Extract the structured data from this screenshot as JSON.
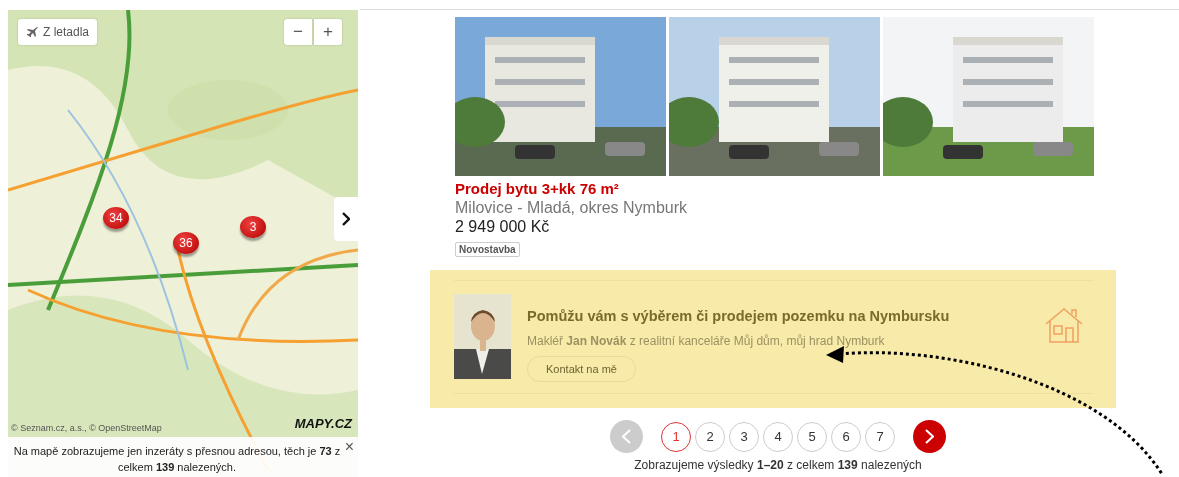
{
  "map": {
    "aerial_button": "Z letadla",
    "zoom_out": "−",
    "zoom_in": "+",
    "markers": [
      {
        "count": "34"
      },
      {
        "count": "36"
      },
      {
        "count": "3"
      }
    ],
    "logo": "MAPY.CZ",
    "attribution": "© Seznam.cz, a.s., © OpenStreetMap",
    "notice": "Na mapě zobrazujeme jen inzeráty s přesnou adresou, těch je **73** z celkem **139** nalezených.",
    "close": "×"
  },
  "listing": {
    "title": "Prodej bytu 3+kk 76 m²",
    "location": "Milovice - Mladá, okres Nymburk",
    "price": "2 949 000 Kč",
    "tags": [
      "Novostavba"
    ]
  },
  "promo": {
    "heading": "Pomůžu vám s výběrem či prodejem pozemku na Nymbursku",
    "text": "Makléř **Jan Novák** z realitní kanceláře Můj dům, můj hrad Nymburk",
    "button": "Kontakt na mě"
  },
  "pagination": {
    "prev_disabled": true,
    "next_disabled": false,
    "pages": [
      {
        "label": "1",
        "selected": true
      },
      {
        "label": "2",
        "selected": false
      },
      {
        "label": "3",
        "selected": false
      },
      {
        "label": "4",
        "selected": false
      },
      {
        "label": "5",
        "selected": false
      },
      {
        "label": "6",
        "selected": false
      },
      {
        "label": "7",
        "selected": false
      }
    ],
    "summary": "Zobrazujeme výsledky **1–20** z celkem **139** nalezených"
  }
}
